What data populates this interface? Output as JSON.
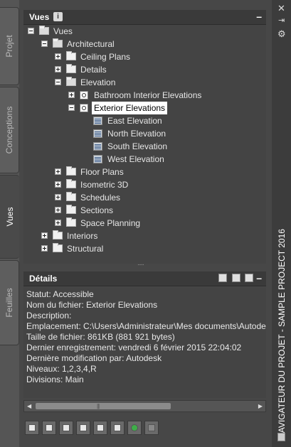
{
  "tabs": [
    {
      "label": "Projet"
    },
    {
      "label": "Conceptions"
    },
    {
      "label": "Vues"
    },
    {
      "label": "Feuilles"
    }
  ],
  "vues_pane": {
    "title": "Vues",
    "info_icon": "i",
    "minimize": "–"
  },
  "tree": {
    "root": "Vues",
    "architectural": "Architectural",
    "ceiling_plans": "Ceiling Plans",
    "details": "Details",
    "elevation": "Elevation",
    "bathroom": "Bathroom Interior Elevations",
    "exterior": "Exterior Elevations",
    "east": "East Elevation",
    "north": "North Elevation",
    "south": "South Elevation",
    "west": "West Elevation",
    "floor_plans": "Floor Plans",
    "isometric": "Isometric 3D",
    "schedules": "Schedules",
    "sections": "Sections",
    "space_planning": "Space Planning",
    "interiors": "Interiors",
    "structural": "Structural"
  },
  "details_pane": {
    "title": "Détails",
    "minimize": "–",
    "lines": [
      "Statut: Accessible",
      "Nom du fichier: Exterior Elevations",
      "Description:",
      "Emplacement: C:\\Users\\Administrateur\\Mes documents\\Autodesk",
      "Taille de fichier: 861KB (881 921 bytes)",
      "Dernier enregistrement: vendredi 6 février 2015  22:04:02",
      "Dernière modification par: Autodesk",
      "Niveaux: 1,2,3,4,R",
      "Divisions: Main"
    ]
  },
  "window": {
    "title": "NAVIGATEUR DU PROJET - SAMPLE PROJECT 2016",
    "close": "✕",
    "pin": "⇥",
    "settings": "⚙"
  },
  "colors": {
    "panel": "#474747",
    "selected_bg": "#ffffff",
    "refresh_green": "#3fae49"
  }
}
